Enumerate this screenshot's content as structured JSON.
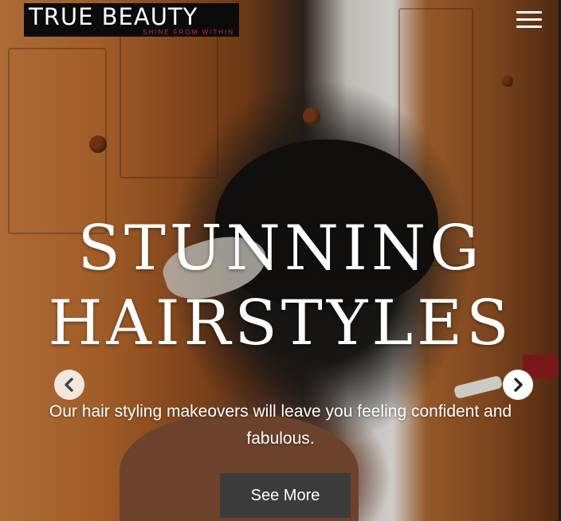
{
  "brand": {
    "name": "TRUE BEAUTY",
    "tagline": "SHINE FROM WITHIN",
    "tagline_color": "#d4282c"
  },
  "nav": {
    "menu_icon": "hamburger-menu-icon"
  },
  "hero": {
    "headline_line1": "STUNNING",
    "headline_line2": "HAIRSTYLES",
    "subtitle": "Our hair styling makeovers will leave you feeling confident and fabulous.",
    "cta_label": "See More",
    "prev_icon": "chevron-left-icon",
    "next_icon": "chevron-right-icon"
  },
  "colors": {
    "button_bg": "#3b3b3b",
    "text": "#ffffff"
  }
}
